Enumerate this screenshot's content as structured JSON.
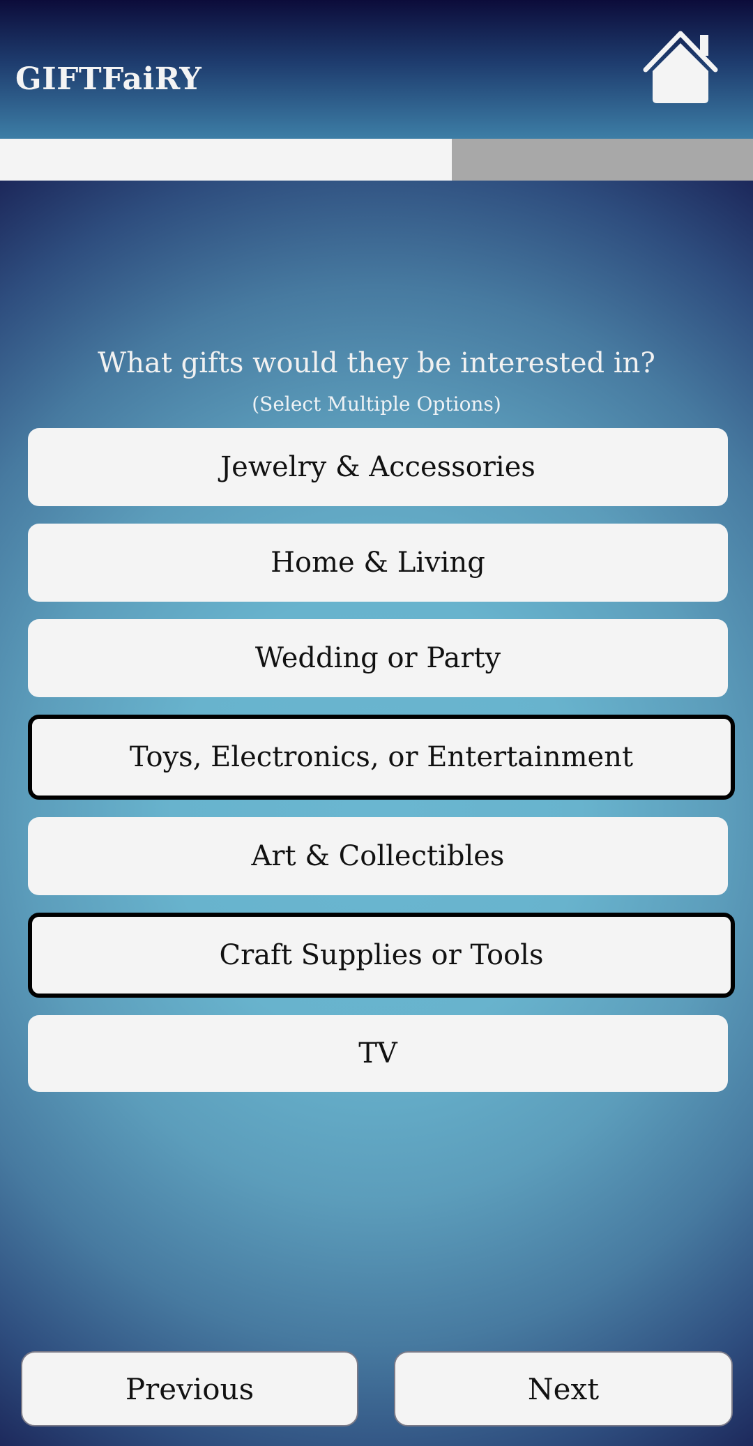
{
  "app": {
    "title": "GIFTFaiRY"
  },
  "colors": {
    "header_top": "#0c0c3a",
    "background_center": "#6ab6d0",
    "progress_fill": "#f4f4f4",
    "progress_track": "#a8a8a8",
    "option_bg": "#f4f4f4",
    "selected_border": "#000000"
  },
  "progress": {
    "fraction": 0.6
  },
  "question": {
    "text": "What gifts would they be interested in?",
    "hint": "(Select Multiple Options)"
  },
  "options": [
    {
      "label": "Jewelry & Accessories",
      "selected": false
    },
    {
      "label": "Home & Living",
      "selected": false
    },
    {
      "label": "Wedding or Party",
      "selected": false
    },
    {
      "label": "Toys, Electronics, or Entertainment",
      "selected": true
    },
    {
      "label": "Art & Collectibles",
      "selected": false
    },
    {
      "label": "Craft Supplies or Tools",
      "selected": true
    },
    {
      "label": "TV",
      "selected": false
    }
  ],
  "navigation": {
    "previous_label": "Previous",
    "next_label": "Next"
  },
  "icons": {
    "home": "home-icon"
  }
}
